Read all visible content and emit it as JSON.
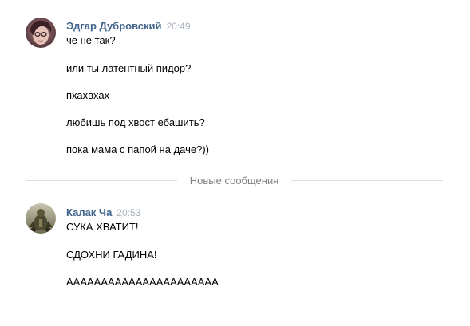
{
  "conversation": {
    "groups": [
      {
        "author": "Эдгар Дубровский",
        "time": "20:49",
        "avatar_icon": "user-avatar-icon",
        "messages": [
          "че не так?",
          "или ты латентный пидор?",
          "пхахвхах",
          "любишь под хвост ебашить?",
          "пока мама с папой на даче?))"
        ]
      },
      {
        "author": "Калак Ча",
        "time": "20:53",
        "avatar_icon": "user-avatar-icon",
        "messages": [
          "СУКА ХВАТИТ!",
          "СДОХНИ ГАДИНА!",
          "АААААААААААААААААААААА"
        ]
      }
    ],
    "new_messages_divider": "Новые сообщения"
  },
  "colors": {
    "author_name": "#42648b",
    "timestamp": "#a8b2bd",
    "divider_text": "#828282",
    "divider_line": "#dce1e6"
  }
}
